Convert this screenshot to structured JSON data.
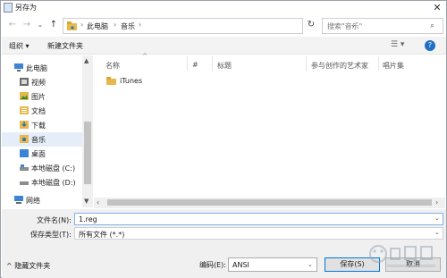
{
  "window": {
    "title": "另存为",
    "close": "✕"
  },
  "nav": {
    "back": "←",
    "forward": "→",
    "recent": "⌄",
    "up": "↑"
  },
  "address": {
    "breadcrumb": [
      "此电脑",
      "音乐"
    ],
    "separator": "›"
  },
  "search": {
    "placeholder": "搜索\"音乐\""
  },
  "toolbar": {
    "organize": "组织 ▾",
    "new_folder": "新建文件夹",
    "help": "?"
  },
  "sidebar": {
    "items": [
      {
        "label": "此电脑",
        "icon": "computer-icon"
      },
      {
        "label": "视频",
        "icon": "video-folder-icon"
      },
      {
        "label": "图片",
        "icon": "pictures-folder-icon"
      },
      {
        "label": "文档",
        "icon": "documents-folder-icon"
      },
      {
        "label": "下载",
        "icon": "downloads-folder-icon"
      },
      {
        "label": "音乐",
        "icon": "music-folder-icon",
        "selected": true
      },
      {
        "label": "桌面",
        "icon": "desktop-folder-icon"
      },
      {
        "label": "本地磁盘 (C:)",
        "icon": "drive-icon"
      },
      {
        "label": "本地磁盘 (D:)",
        "icon": "drive-icon"
      },
      {
        "label": "网络",
        "icon": "network-icon"
      }
    ]
  },
  "columns": [
    "名称",
    "#",
    "标题",
    "参与创作的艺术家",
    "唱片集"
  ],
  "files": [
    {
      "name": "iTunes",
      "icon": "folder-icon"
    }
  ],
  "form": {
    "filename_label": "文件名(N):",
    "filename_value": "1.reg",
    "filetype_label": "保存类型(T):",
    "filetype_value": "所有文件 (*.*)"
  },
  "footer": {
    "hide_folders": "隐藏文件夹",
    "encoding_label": "编码(E):",
    "encoding_value": "ANSI",
    "save": "保存(S)",
    "cancel": "取消"
  },
  "colors": {
    "accent": "#0078d7",
    "selection": "#e5eef8",
    "folder": "#e8b84a"
  }
}
